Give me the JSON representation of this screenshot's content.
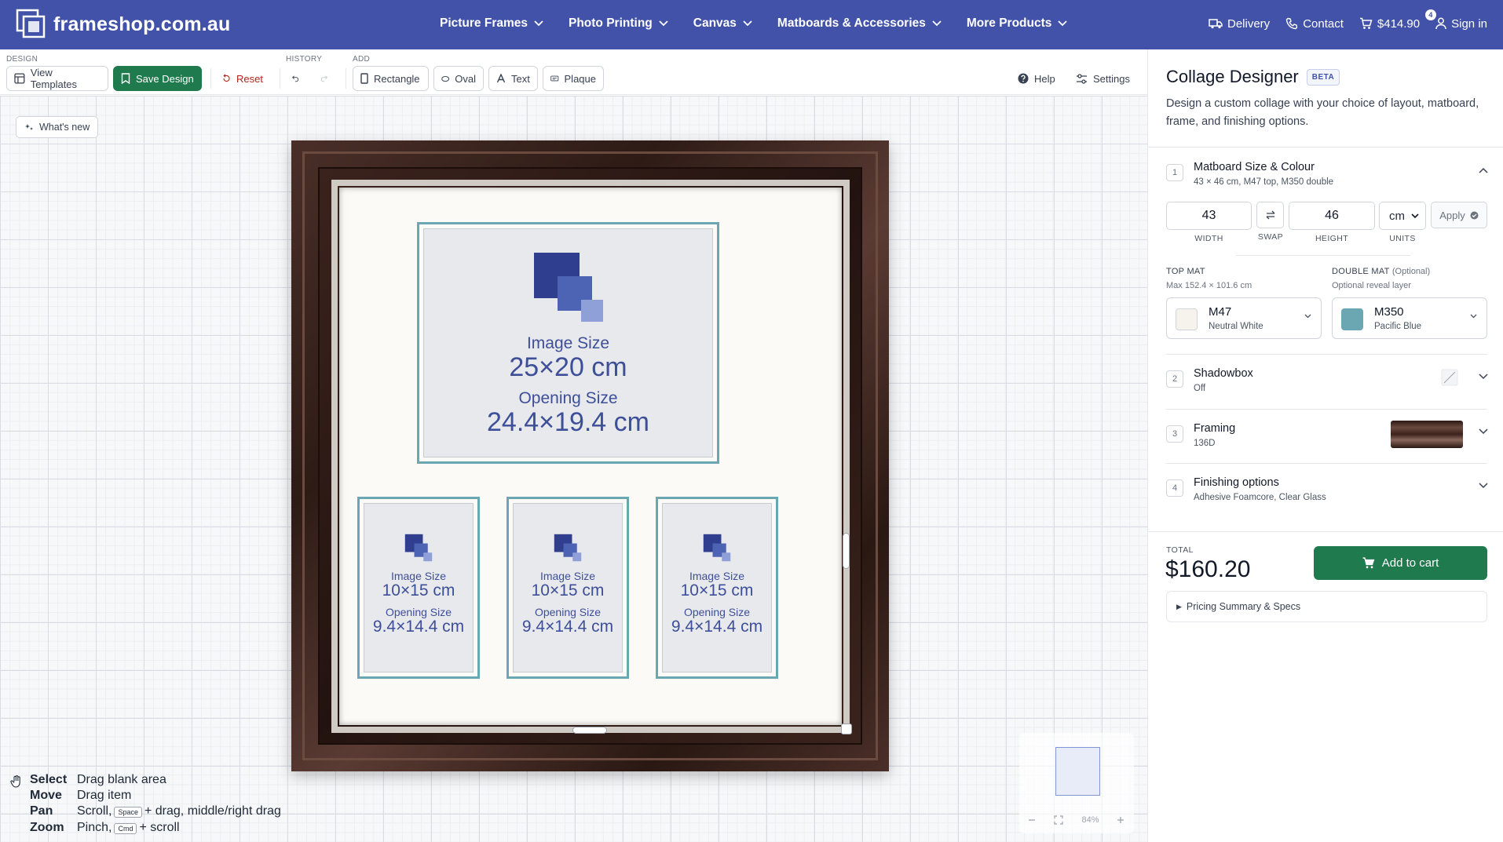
{
  "nav": {
    "logo_text": "frameshop.com.au",
    "menu": [
      {
        "label": "Picture Frames"
      },
      {
        "label": "Photo Printing"
      },
      {
        "label": "Canvas"
      },
      {
        "label": "Matboards & Accessories"
      },
      {
        "label": "More Products"
      }
    ],
    "delivery": "Delivery",
    "contact": "Contact",
    "cart_amount": "$414.90",
    "cart_count": "4",
    "sign_in": "Sign in",
    "brand_color": "#4152a8"
  },
  "toolbar": {
    "design_label": "DESIGN",
    "history_label": "HISTORY",
    "add_label": "ADD",
    "view_templates": "View Templates",
    "save_design": "Save Design",
    "reset": "Reset",
    "rectangle": "Rectangle",
    "oval": "Oval",
    "text": "Text",
    "plaque": "Plaque",
    "help": "Help",
    "settings": "Settings"
  },
  "canvas": {
    "whats_new": "What's new",
    "large_opening": {
      "image_size_label": "Image Size",
      "image_size": "25×20 cm",
      "opening_size_label": "Opening Size",
      "opening_size": "24.4×19.4 cm"
    },
    "small_openings": [
      {
        "image_size_label": "Image Size",
        "image_size": "10×15 cm",
        "opening_size_label": "Opening Size",
        "opening_size": "9.4×14.4 cm"
      },
      {
        "image_size_label": "Image Size",
        "image_size": "10×15 cm",
        "opening_size_label": "Opening Size",
        "opening_size": "9.4×14.4 cm"
      },
      {
        "image_size_label": "Image Size",
        "image_size": "10×15 cm",
        "opening_size_label": "Opening Size",
        "opening_size": "9.4×14.4 cm"
      }
    ],
    "shortcuts": [
      {
        "key": "Select",
        "desc": "Drag blank area"
      },
      {
        "key": "Move",
        "desc": "Drag item"
      },
      {
        "key": "Pan",
        "desc_pre": "Scroll,",
        "kbd": "Space",
        "desc_post": "+ drag, middle/right drag"
      },
      {
        "key": "Zoom",
        "desc_pre": "Pinch,",
        "kbd": "Cmd",
        "desc_post": "+ scroll"
      }
    ],
    "zoom_level": "84%"
  },
  "panel": {
    "title": "Collage Designer",
    "beta": "BETA",
    "description": "Design a custom collage with your choice of layout, matboard, frame, and finishing options.",
    "sections": [
      {
        "num": "1",
        "title": "Matboard Size & Colour",
        "subtitle": "43 × 46 cm, M47 top, M350 double"
      },
      {
        "num": "2",
        "title": "Shadowbox",
        "subtitle": "Off"
      },
      {
        "num": "3",
        "title": "Framing",
        "subtitle": "136D"
      },
      {
        "num": "4",
        "title": "Finishing options",
        "subtitle": "Adhesive Foamcore, Clear Glass"
      }
    ],
    "dimensions": {
      "width_value": "43",
      "width_label": "WIDTH",
      "swap_label": "SWAP",
      "height_value": "46",
      "height_label": "HEIGHT",
      "units_value": "cm",
      "units_label": "UNITS",
      "apply": "Apply"
    },
    "top_mat": {
      "caption": "TOP MAT",
      "sub": "Max 152.4 × 101.6 cm",
      "code": "M47",
      "name": "Neutral White",
      "color": "#f6f3ec"
    },
    "double_mat": {
      "caption": "DOUBLE MAT",
      "optional": "(Optional)",
      "sub": "Optional reveal layer",
      "code": "M350",
      "name": "Pacific Blue",
      "color": "#6aa7b3"
    },
    "total_label": "TOTAL",
    "total_value": "$160.20",
    "add_to_cart": "Add to cart",
    "pricing_summary": "Pricing Summary & Specs"
  }
}
